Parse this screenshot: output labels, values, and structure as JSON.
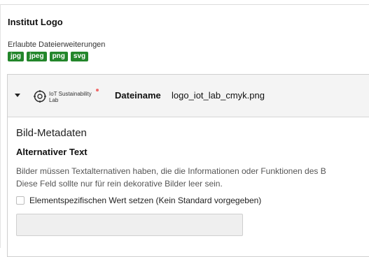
{
  "section": {
    "title": "Institut Logo"
  },
  "extensions": {
    "label": "Erlaubte Dateierweiterungen",
    "items": [
      "jpg",
      "jpeg",
      "png",
      "svg"
    ]
  },
  "file": {
    "thumbnail": {
      "line1": "IoT Sustainability",
      "line2": "Lab"
    },
    "label": "Dateiname",
    "name": "logo_iot_lab_cmyk.png"
  },
  "metadata": {
    "heading": "Bild-Metadaten",
    "alt_text": {
      "heading": "Alternativer Text",
      "help_line1": "Bilder müssen Textalternativen haben, die die Informationen oder Funktionen des B",
      "help_line2": "Diese Feld sollte nur für rein dekorative Bilder leer sein.",
      "checkbox_label": "Elementspezifischen Wert setzen (Kein Standard vorgegeben)",
      "input_value": ""
    }
  },
  "colors": {
    "badge": "#23862b",
    "panel_header": "#f4f4f4"
  }
}
